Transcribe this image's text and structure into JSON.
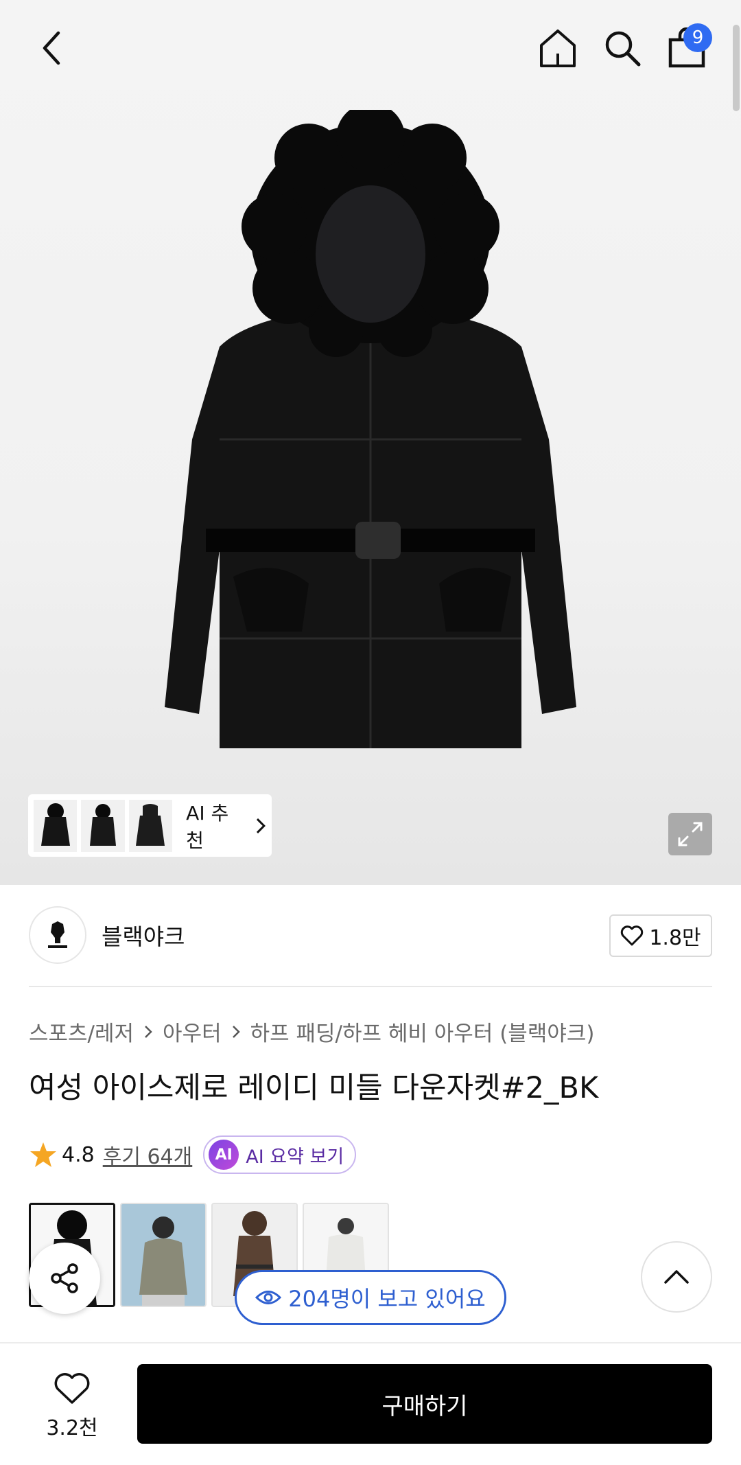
{
  "topbar": {
    "cart_count": "9"
  },
  "ai_recommend": {
    "label": "AI 추천"
  },
  "brand": {
    "name": "블랙야크",
    "likes": "1.8만"
  },
  "breadcrumb": [
    "스포츠/레저",
    "아우터",
    "하프 패딩/하프 헤비 아우터 (블랙야크)"
  ],
  "product": {
    "title": "여성 아이스제로 레이디 미들 다운자켓#2_BK",
    "rating": "4.8",
    "reviews": "후기 64개",
    "ai_badge": "AI",
    "ai_summary": "AI 요약 보기"
  },
  "variants": [
    {
      "color": "#1a1a1a",
      "bg": "#f7f7f7"
    },
    {
      "color": "#8a8a78",
      "bg": "#a9c7d9"
    },
    {
      "color": "#5b4334",
      "bg": "#efefef"
    },
    {
      "color": "#f1f1ef",
      "bg": "#f6f6f6"
    }
  ],
  "viewers": {
    "text": "204명이 보고 있어요"
  },
  "bottom": {
    "wish_count": "3.2천",
    "buy_label": "구매하기"
  },
  "colors": {
    "accent_blue": "#2f6bf2",
    "viewer_blue": "#2e5fd0",
    "star": "#f5a623",
    "ai_purple": "#7b44e3"
  }
}
